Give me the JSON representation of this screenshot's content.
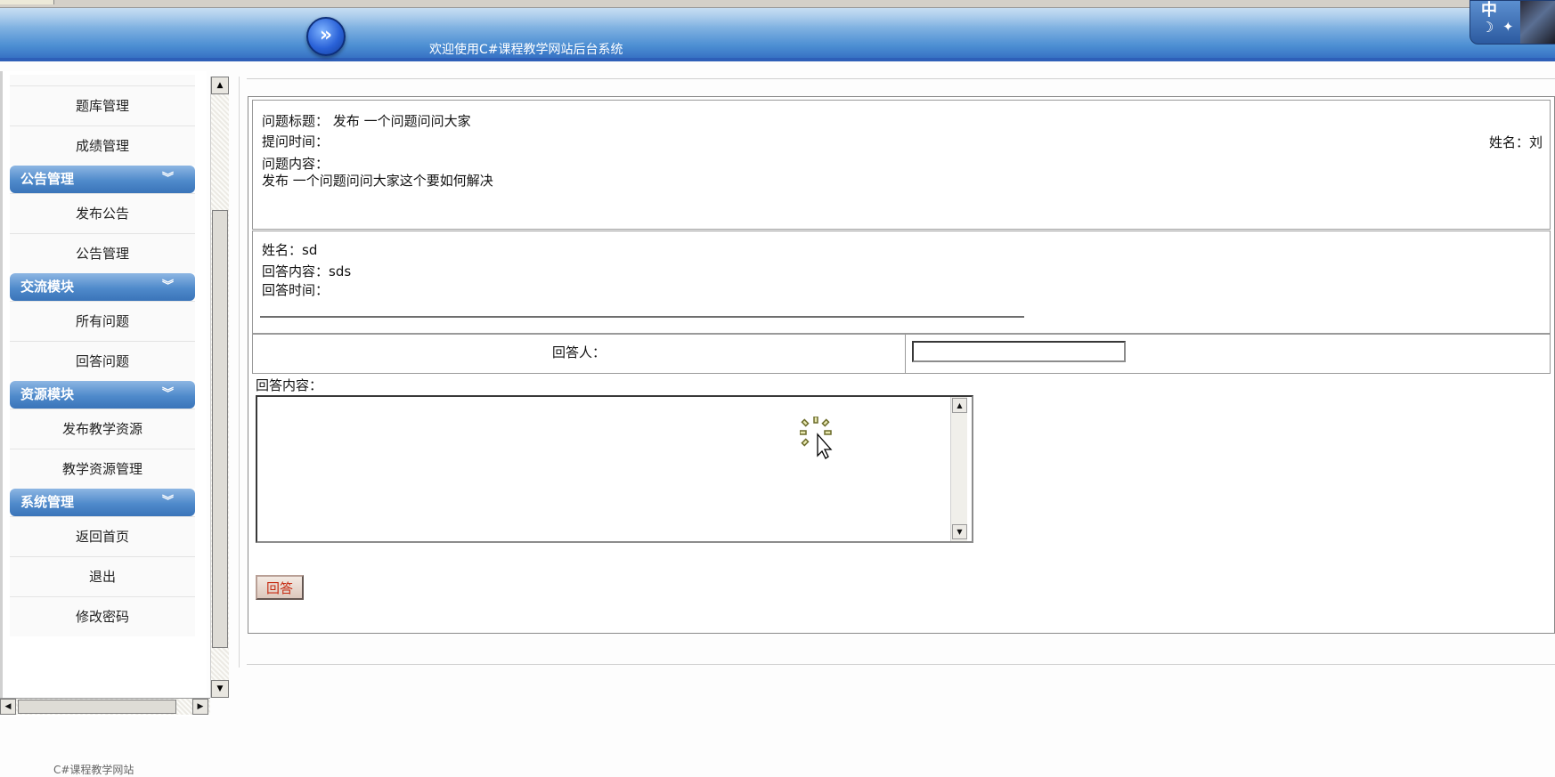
{
  "header": {
    "welcome": "欢迎使用C#课程教学网站后台系统",
    "nav_button": "»",
    "ime": {
      "lang": "中",
      "moon": "☽",
      "shirt": "👕"
    }
  },
  "sidebar": {
    "items_top": [
      "题库管理",
      "成绩管理"
    ],
    "groups": [
      {
        "title": "公告管理",
        "items": [
          "发布公告",
          "公告管理"
        ]
      },
      {
        "title": "交流模块",
        "items": [
          "所有问题",
          "回答问题"
        ]
      },
      {
        "title": "资源模块",
        "items": [
          "发布教学资源",
          "教学资源管理"
        ]
      },
      {
        "title": "系统管理",
        "items": [
          "返回首页",
          "退出",
          "修改密码"
        ]
      }
    ],
    "chevron": "»",
    "cutoff_text": "C#课程教学网站"
  },
  "question": {
    "title_label": "问题标题：",
    "title_value": "发布 一个问题问问大家",
    "time_label": "提问时间：",
    "time_value": "",
    "name_label": "姓名：",
    "name_value": "刘",
    "content_label": "问题内容：",
    "content_value": "发布 一个问题问问大家这个要如何解决"
  },
  "answer": {
    "name_label": "姓名：",
    "name_value": "sd",
    "content_label": "回答内容：",
    "content_value": "sds",
    "time_label": "回答时间："
  },
  "form": {
    "responder_label": "回答人：",
    "responder_value": "",
    "reply_label": "回答内容：",
    "reply_value": "",
    "submit_label": "回答"
  },
  "scrollbar": {
    "up": "▲",
    "down": "▼",
    "left": "◀",
    "right": "▶"
  }
}
